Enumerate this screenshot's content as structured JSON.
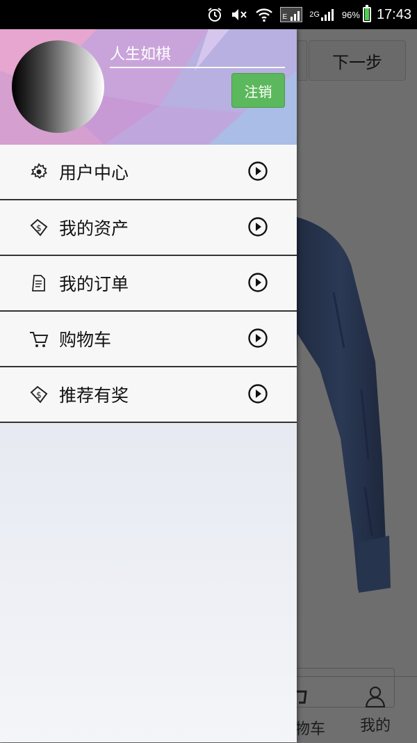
{
  "status_bar": {
    "network_label": "2G",
    "battery_percent": "96%",
    "battery_level": 0.96,
    "time": "17:43"
  },
  "background_screen": {
    "next_button_label": "下一步",
    "bottom_tabs": [
      {
        "label": "购物车",
        "visible_text": "物车",
        "icon": "cart-icon"
      },
      {
        "label": "我的",
        "icon": "person-icon"
      }
    ]
  },
  "drawer": {
    "username": "人生如棋",
    "logout_label": "注销",
    "menu": [
      {
        "label": "用户中心",
        "icon": "gear-icon"
      },
      {
        "label": "我的资产",
        "icon": "money-tag-icon"
      },
      {
        "label": "我的订单",
        "icon": "document-icon"
      },
      {
        "label": "购物车",
        "icon": "cart-icon"
      },
      {
        "label": "推荐有奖",
        "icon": "money-tag-icon"
      }
    ]
  },
  "colors": {
    "logout_button": "#5cb85c",
    "status_bar": "#000000",
    "menu_item_bg": "#f7f7f7"
  }
}
